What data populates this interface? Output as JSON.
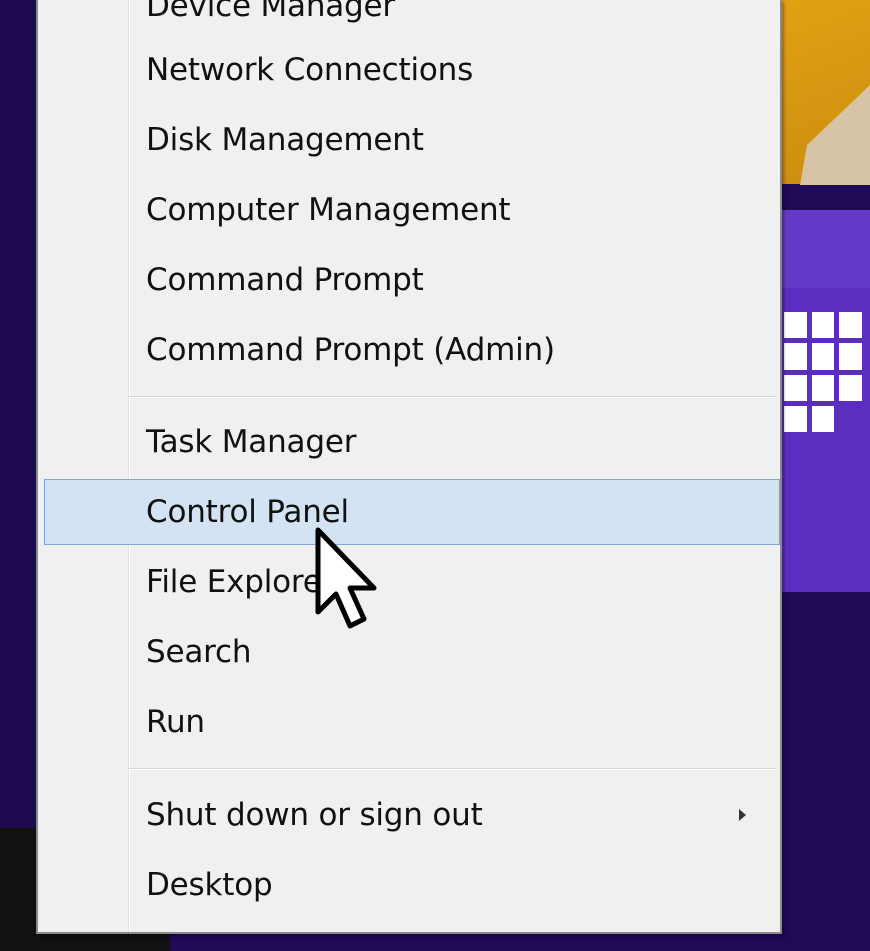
{
  "menu": {
    "items": [
      {
        "label": "Device Manager"
      },
      {
        "label": "Network Connections"
      },
      {
        "label": "Disk Management"
      },
      {
        "label": "Computer Management"
      },
      {
        "label": "Command Prompt"
      },
      {
        "label": "Command Prompt (Admin)"
      },
      {
        "label": "Task Manager"
      },
      {
        "label": "Control Panel"
      },
      {
        "label": "File Explorer"
      },
      {
        "label": "Search"
      },
      {
        "label": "Run"
      },
      {
        "label": "Shut down or sign out"
      },
      {
        "label": "Desktop"
      }
    ],
    "hovered_item": "Control Panel"
  },
  "icons": {
    "submenu_arrow": "chevron-right-icon",
    "cursor": "mouse-pointer-icon",
    "tile_calendar": "calendar-icon"
  },
  "colors": {
    "menu_background": "#f0f0f0",
    "highlight_background": "#d3e3f4",
    "highlight_border": "#7ba7d8",
    "start_background": "#1f0a55",
    "tile_purple": "#5b2ec0",
    "tile_gold": "#e3a214"
  }
}
